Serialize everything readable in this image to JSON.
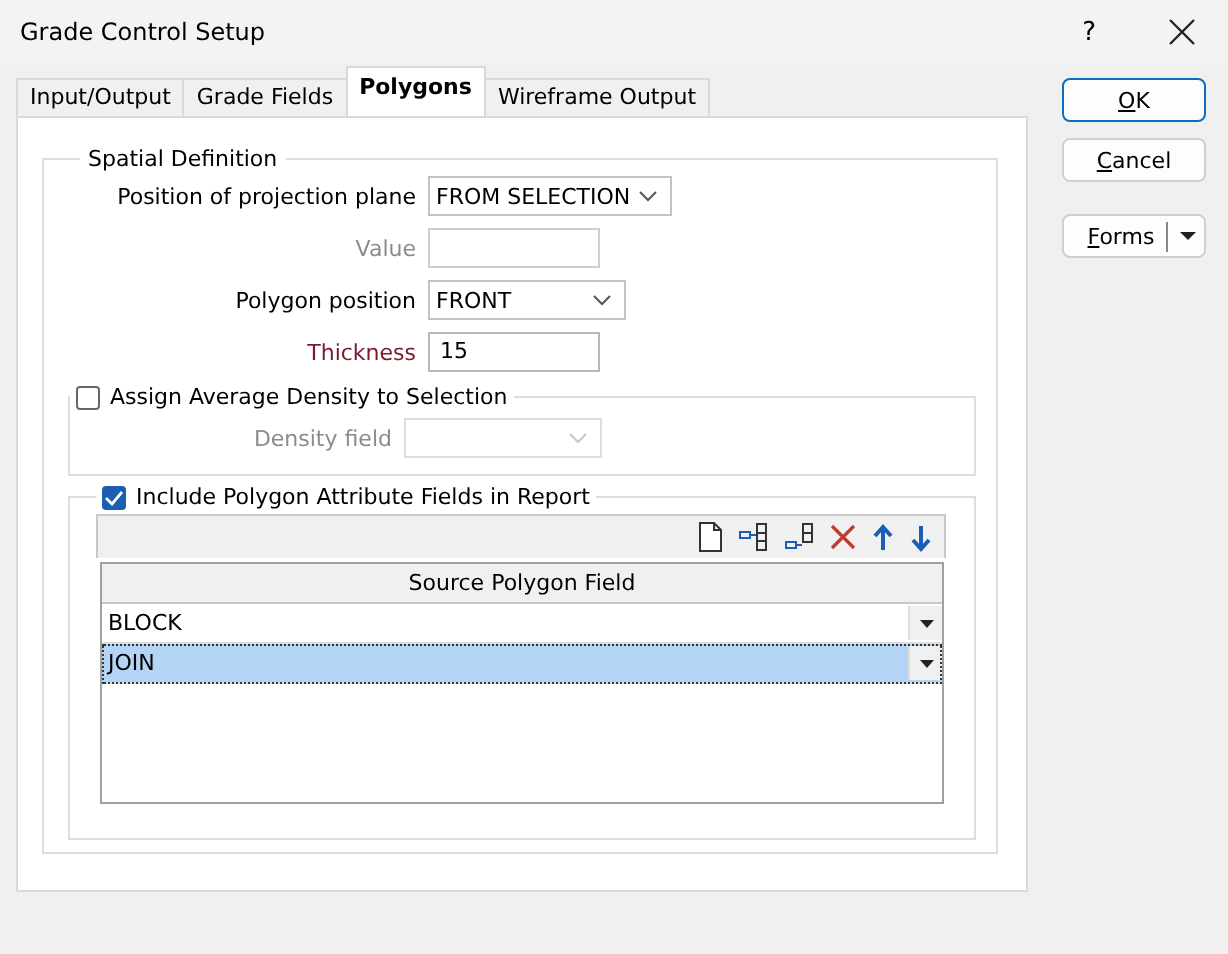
{
  "window": {
    "title": "Grade Control Setup",
    "help": "?"
  },
  "tabs": [
    {
      "label": "Input/Output",
      "selected": false
    },
    {
      "label": "Grade Fields",
      "selected": false
    },
    {
      "label": "Polygons",
      "selected": true
    },
    {
      "label": "Wireframe Output",
      "selected": false
    }
  ],
  "spatial_definition": {
    "title": "Spatial Definition",
    "fields": [
      {
        "kind": "dropdown",
        "label": "Position of projection plane",
        "value": "FROM SELECTION",
        "disabled": false,
        "required": false
      },
      {
        "kind": "text",
        "label": "Value",
        "disabled": true,
        "required": false
      },
      {
        "kind": "dropdown",
        "label": "Polygon position",
        "value": "FRONT",
        "disabled": false,
        "required": false
      },
      {
        "kind": "text",
        "label": "Thickness",
        "value": "15",
        "disabled": false,
        "required": true
      }
    ]
  },
  "density": {
    "label": "Assign Average Density to Selection",
    "checked": false,
    "fields": [
      {
        "kind": "dropdown",
        "label": "Density field",
        "disabled": true,
        "required": false
      }
    ]
  },
  "attributes": {
    "label": "Include Polygon Attribute Fields in Report",
    "checked": true,
    "table": {
      "columns": [
        "Source Polygon Field"
      ],
      "rows": [
        {
          "value": "BLOCK",
          "selected": false
        },
        {
          "value": "JOIN",
          "selected": true
        }
      ]
    }
  },
  "buttons": [
    {
      "kind": "default",
      "label": "OK",
      "access_key_underlined": true
    },
    {
      "kind": "normal",
      "label": "Cancel",
      "access_key_underlined": true
    },
    {
      "kind": "split",
      "label": "Forms",
      "access_key_underlined": true
    }
  ]
}
